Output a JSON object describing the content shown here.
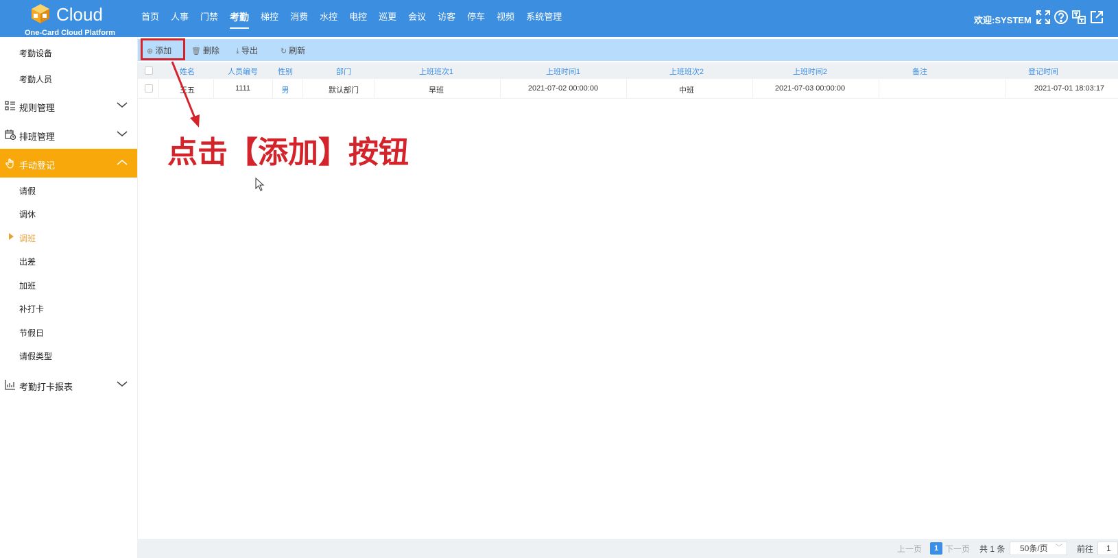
{
  "header": {
    "logo_text": "Cloud",
    "logo_sub": "One-Card Cloud Platform",
    "nav": [
      "首页",
      "人事",
      "门禁",
      "考勤",
      "梯控",
      "消费",
      "水控",
      "电控",
      "巡更",
      "会议",
      "访客",
      "停车",
      "视频",
      "系统管理"
    ],
    "active_nav": "考勤",
    "welcome": "欢迎:SYSTEM",
    "icons": [
      "fullscreen-icon",
      "help-icon",
      "translate-icon",
      "external-link-icon"
    ]
  },
  "sidebar": {
    "top_items": [
      "考勤设备",
      "考勤人员"
    ],
    "groups": [
      {
        "label": "规则管理",
        "icon": "list-icon",
        "expanded": false
      },
      {
        "label": "排班管理",
        "icon": "calendar-icon",
        "expanded": false
      },
      {
        "label": "手动登记",
        "icon": "hand-icon",
        "expanded": true
      },
      {
        "label": "考勤打卡报表",
        "icon": "chart-icon",
        "expanded": false
      }
    ],
    "sub_items": [
      "请假",
      "调休",
      "调班",
      "出差",
      "加班",
      "补打卡",
      "节假日",
      "请假类型"
    ],
    "current_sub": "调班",
    "accent": "#f8a80b"
  },
  "toolbar": {
    "add": "添加",
    "delete": "删除",
    "export": "导出",
    "refresh": "刷新"
  },
  "table": {
    "columns": [
      "姓名",
      "人员编号",
      "性别",
      "部门",
      "上班班次1",
      "上班时间1",
      "上班班次2",
      "上班时间2",
      "备注",
      "登记时间"
    ],
    "rows": [
      [
        "王五",
        "1111",
        "男",
        "默认部门",
        "早班",
        "2021-07-02 00:00:00",
        "中班",
        "2021-07-03 00:00:00",
        "",
        "2021-07-01 18:03:17"
      ]
    ]
  },
  "annotation": "点击【添加】按钮",
  "pagination": {
    "prev": "上一页",
    "current": "1",
    "next": "下一页",
    "total": "共 1 条",
    "page_size": "50条/页",
    "goto_label": "前往",
    "goto_value": "1"
  }
}
